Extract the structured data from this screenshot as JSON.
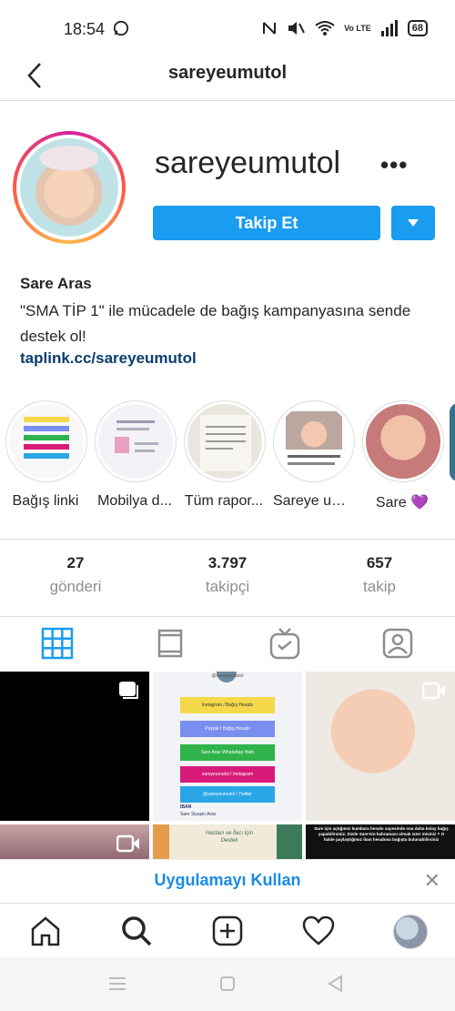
{
  "status": {
    "time": "18:54",
    "battery": "68",
    "net": "Vo LTE"
  },
  "header": {
    "title": "sareyeumutol"
  },
  "profile": {
    "username": "sareyeumutol",
    "follow_label": "Takip Et",
    "name": "Sare Aras",
    "bio": "\"SMA TİP 1\" ile mücadele de bağış kampanyasına sende destek ol!",
    "link": "taplink.cc/sareyeumutol"
  },
  "highlights": [
    {
      "label": "Bağış linki"
    },
    {
      "label": "Mobilya d..."
    },
    {
      "label": "Tüm rapor..."
    },
    {
      "label": "Sareye um..."
    },
    {
      "label": "Sare 💜"
    }
  ],
  "stats": [
    {
      "value": "27",
      "label": "gönderi"
    },
    {
      "value": "3.797",
      "label": "takipçi"
    },
    {
      "value": "657",
      "label": "takip"
    }
  ],
  "grid_texts": {
    "handle": "@sareyeumutol",
    "buttons": [
      "Instagram / Bağış Hesabı",
      "Paypal / Bağış Hesabı",
      "Sare Aras WhatsApp Hattı",
      "sareyeumutol / Instagram",
      "@sareyeumutol / Twitter"
    ],
    "iban": "IBAN",
    "iban_name": "Sare Siyaşin Aras",
    "post_text": "Sare için açtığımız kumbara hesabı sayesinde ona daha kolay bağış yapabilirsiniz. Sizde Sare'nin kahramanı olmak ister misiniz ? O halde paylaştığımız iban hesabına bağışta bulunabilirsiniz",
    "highlight2_text": "Hastacı ve İlacı İçin Destek"
  },
  "banner": {
    "text": "Uygulamayı Kullan"
  },
  "colors": {
    "accent": "#1a9cf0",
    "link": "#0b3d6d",
    "banner": "#1a8be8"
  }
}
